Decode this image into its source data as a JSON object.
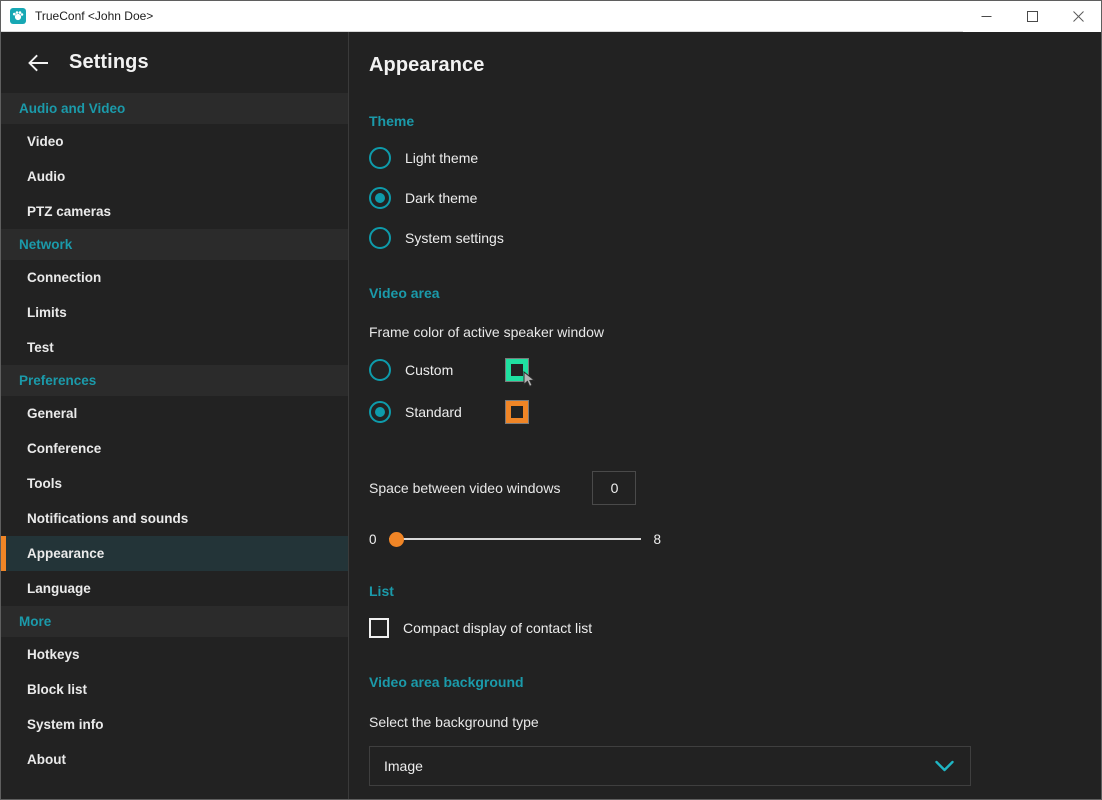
{
  "window": {
    "title": "TrueConf <John Doe>",
    "app_icon": "trueconf-logo-icon",
    "controls": {
      "minimize": "minimize-icon",
      "maximize": "maximize-icon",
      "close": "close-icon"
    }
  },
  "sidebar": {
    "back_icon": "back-arrow-icon",
    "title": "Settings",
    "groups": [
      {
        "label": "Audio and Video",
        "items": [
          {
            "label": "Video",
            "selected": false
          },
          {
            "label": "Audio",
            "selected": false
          },
          {
            "label": "PTZ cameras",
            "selected": false
          }
        ]
      },
      {
        "label": "Network",
        "items": [
          {
            "label": "Connection",
            "selected": false
          },
          {
            "label": "Limits",
            "selected": false
          },
          {
            "label": "Test",
            "selected": false
          }
        ]
      },
      {
        "label": "Preferences",
        "items": [
          {
            "label": "General",
            "selected": false
          },
          {
            "label": "Conference",
            "selected": false
          },
          {
            "label": "Tools",
            "selected": false
          },
          {
            "label": "Notifications and sounds",
            "selected": false
          },
          {
            "label": "Appearance",
            "selected": true
          },
          {
            "label": "Language",
            "selected": false
          }
        ]
      },
      {
        "label": "More",
        "items": [
          {
            "label": "Hotkeys",
            "selected": false
          },
          {
            "label": "Block list",
            "selected": false
          },
          {
            "label": "System info",
            "selected": false
          },
          {
            "label": "About",
            "selected": false
          }
        ]
      }
    ]
  },
  "main": {
    "page_title": "Appearance",
    "theme": {
      "section_label": "Theme",
      "options": [
        {
          "label": "Light theme",
          "selected": false
        },
        {
          "label": "Dark theme",
          "selected": true
        },
        {
          "label": "System settings",
          "selected": false
        }
      ]
    },
    "video_area": {
      "section_label": "Video area",
      "frame_color_label": "Frame color of active speaker window",
      "options": [
        {
          "label": "Custom",
          "selected": false,
          "swatch_color": "#1fe0a0"
        },
        {
          "label": "Standard",
          "selected": true,
          "swatch_color": "#f08526"
        }
      ],
      "space_label": "Space between video windows",
      "space_value": "0",
      "slider_min": "0",
      "slider_max": "8",
      "slider_value": 0
    },
    "list": {
      "section_label": "List",
      "compact_label": "Compact display of contact list",
      "compact_checked": false
    },
    "video_background": {
      "section_label": "Video area background",
      "select_label": "Select the background type",
      "select_value": "Image",
      "chevron_icon": "chevron-down-icon"
    }
  },
  "colors": {
    "accent_teal": "#1b9aaa",
    "accent_orange": "#f08526",
    "selected_row_bg": "#233438",
    "panel_bg": "#222222",
    "group_header_bg": "#2b2b2b"
  }
}
